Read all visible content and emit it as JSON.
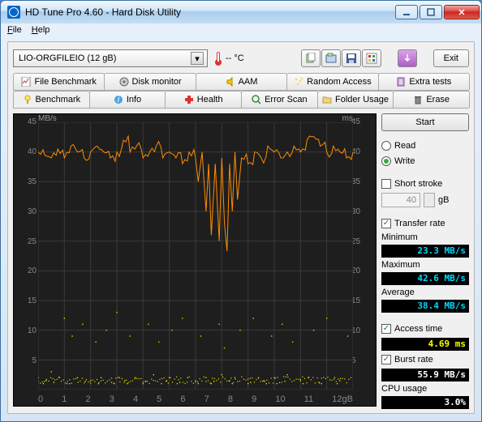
{
  "window": {
    "title": "HD Tune Pro 4.60 - Hard Disk Utility"
  },
  "menu": {
    "file": "File",
    "help": "Help"
  },
  "toolbar": {
    "drive": "LIO-ORGFILEIO (12 gB)",
    "temp": "-- °C",
    "exit": "Exit"
  },
  "tabs_top": {
    "file_benchmark": "File Benchmark",
    "disk_monitor": "Disk monitor",
    "aam": "AAM",
    "random_access": "Random Access",
    "extra_tests": "Extra tests"
  },
  "tabs_bottom": {
    "benchmark": "Benchmark",
    "info": "Info",
    "health": "Health",
    "error_scan": "Error Scan",
    "folder_usage": "Folder Usage",
    "erase": "Erase"
  },
  "side": {
    "start": "Start",
    "read": "Read",
    "write": "Write",
    "short_stroke": "Short stroke",
    "stroke_val": "40",
    "stroke_unit": "gB",
    "transfer_rate": "Transfer rate",
    "minimum": "Minimum",
    "minimum_v": "23.3 MB/s",
    "maximum": "Maximum",
    "maximum_v": "42.6 MB/s",
    "average": "Average",
    "average_v": "38.4 MB/s",
    "access_time": "Access time",
    "access_time_v": "4.69 ms",
    "burst_rate": "Burst rate",
    "burst_rate_v": "55.9 MB/s",
    "cpu_usage": "CPU usage",
    "cpu_usage_v": "3.0%"
  },
  "chart_data": {
    "type": "line+scatter",
    "title": "",
    "x_unit": "gB",
    "xlim": [
      0,
      12
    ],
    "y_left_label": "MB/s",
    "y_left_lim": [
      0,
      45
    ],
    "y_left_ticks": [
      0,
      5,
      10,
      15,
      20,
      25,
      30,
      35,
      40,
      45
    ],
    "y_right_label": "ms",
    "y_right_lim": [
      0,
      45
    ],
    "y_right_ticks": [
      0,
      5,
      10,
      15,
      20,
      25,
      30,
      35,
      40,
      45
    ],
    "x_ticks": [
      0,
      1,
      2,
      3,
      4,
      5,
      6,
      7,
      8,
      9,
      10,
      11,
      "12gB"
    ],
    "series": [
      {
        "name": "Transfer rate (write)",
        "axis": "left",
        "color": "#ff8c00",
        "x": [
          0,
          0.25,
          0.5,
          0.75,
          1,
          1.25,
          1.5,
          1.75,
          2,
          2.25,
          2.5,
          2.75,
          3,
          3.25,
          3.5,
          3.75,
          4,
          4.25,
          4.5,
          4.75,
          5,
          5.25,
          5.5,
          5.75,
          6,
          6.1,
          6.25,
          6.4,
          6.5,
          6.6,
          6.75,
          6.9,
          7,
          7.1,
          7.2,
          7.3,
          7.4,
          7.5,
          7.6,
          7.75,
          8,
          8.25,
          8.5,
          8.75,
          9,
          9.25,
          9.5,
          9.75,
          10,
          10.25,
          10.5,
          10.75,
          11,
          11.25,
          11.5,
          11.75,
          12
        ],
        "y": [
          40,
          39.5,
          39,
          40.5,
          39,
          41,
          40,
          39,
          40,
          41,
          40,
          39,
          40,
          42,
          40,
          41,
          39,
          40,
          41,
          39,
          40,
          39,
          38,
          40,
          39,
          35,
          40,
          30,
          38,
          26,
          38,
          25,
          39,
          28,
          23.3,
          38,
          30,
          40,
          32,
          39,
          38,
          40,
          39,
          41,
          40,
          39,
          40,
          41,
          40,
          42,
          42.6,
          41,
          40,
          41,
          40,
          39,
          40
        ]
      },
      {
        "name": "Access time",
        "axis": "right",
        "color": "#dede00",
        "type": "scatter",
        "x": [
          0,
          0.3,
          0.5,
          0.8,
          1,
          1.1,
          1.3,
          1.5,
          1.7,
          2,
          2.2,
          2.4,
          2.6,
          2.9,
          3,
          3.1,
          3.3,
          3.5,
          3.7,
          4,
          4.2,
          4.4,
          4.6,
          4.9,
          5,
          5.1,
          5.3,
          5.5,
          5.7,
          6,
          6.2,
          6.4,
          6.6,
          6.9,
          7,
          7.1,
          7.3,
          7.5,
          7.7,
          8,
          8.2,
          8.4,
          8.6,
          8.9,
          9,
          9.1,
          9.3,
          9.5,
          9.7,
          10,
          10.3,
          10.5,
          10.8,
          11,
          11.3,
          11.5,
          11.8,
          0.2,
          0.6,
          1.2,
          1.8,
          2.3,
          2.8,
          3.4,
          4.1,
          4.7,
          5.4,
          6.1,
          6.7,
          7.4,
          8.1,
          8.7,
          9.4,
          10.1,
          10.7,
          11.4
        ],
        "y": [
          2,
          1.5,
          3,
          2,
          12,
          1,
          9,
          2,
          11,
          1.5,
          8,
          2,
          10,
          1,
          13,
          2,
          1.5,
          9,
          2,
          1,
          11,
          2.5,
          8,
          1.5,
          2,
          10,
          1,
          12,
          2,
          1.5,
          9,
          2,
          1,
          11,
          2.5,
          7,
          1.5,
          2,
          10,
          1,
          12,
          2,
          1.5,
          9,
          2,
          1,
          11,
          2.5,
          8,
          1.5,
          2,
          10,
          1,
          12,
          2,
          1.5,
          9,
          1,
          1.2,
          1,
          1.4,
          1,
          1.2,
          1,
          1.4,
          1,
          1.2,
          1,
          1.4,
          1,
          1.2,
          1,
          1.4,
          1,
          1.2,
          1
        ]
      }
    ]
  }
}
